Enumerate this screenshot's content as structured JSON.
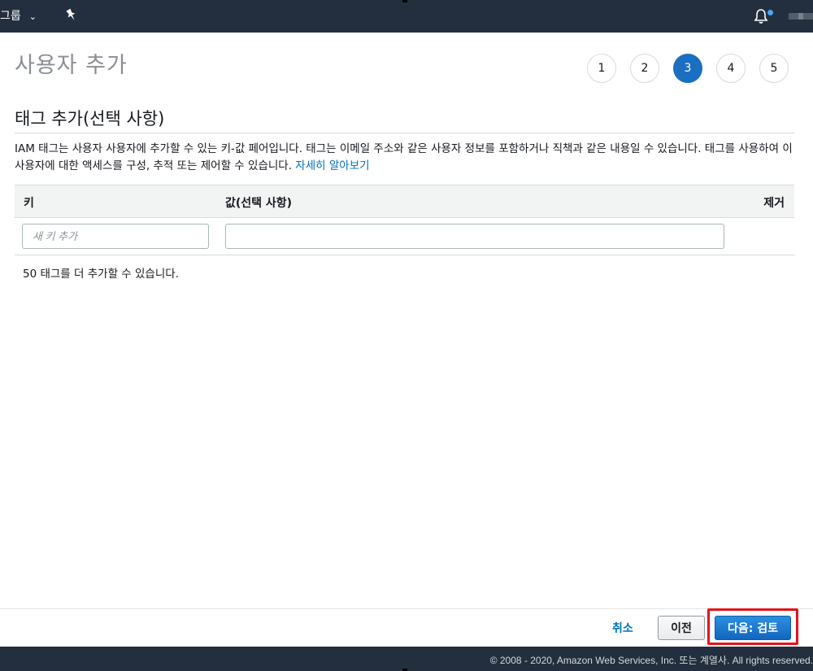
{
  "topbar": {
    "group_label": "그룹",
    "icons": {
      "chevron": "chevron-down-icon",
      "pin": "pin-icon",
      "bell": "bell-icon"
    },
    "notification_color": "#4da3ff"
  },
  "header": {
    "title": "사용자 추가",
    "steps": [
      "1",
      "2",
      "3",
      "4",
      "5"
    ],
    "active_step": 3
  },
  "section": {
    "title": "태그 추가(선택 사항)",
    "description": "IAM 태그는 사용자 사용자에 추가할 수 있는 키-값 페어입니다. 태그는 이메일 주소와 같은 사용자 정보를 포함하거나 직책과 같은 내용일 수 있습니다. 태그를 사용하여 이 사용자에 대한 액세스를 구성, 추적 또는 제어할 수 있습니다.",
    "learn_more": "자세히 알아보기"
  },
  "table": {
    "col_key": "키",
    "col_value": "값(선택 사항)",
    "col_remove": "제거",
    "key_placeholder": "새 키 추가",
    "key_value": "",
    "value_value": ""
  },
  "remaining_text": "50 태그를 더 추가할 수 있습니다.",
  "actions": {
    "cancel": "취소",
    "previous": "이전",
    "next": "다음: 검토",
    "highlight_color": "#e3141c"
  },
  "footer": {
    "copyright": "© 2008 - 2020, Amazon Web Services, Inc. 또는 계열사. All rights reserved."
  }
}
